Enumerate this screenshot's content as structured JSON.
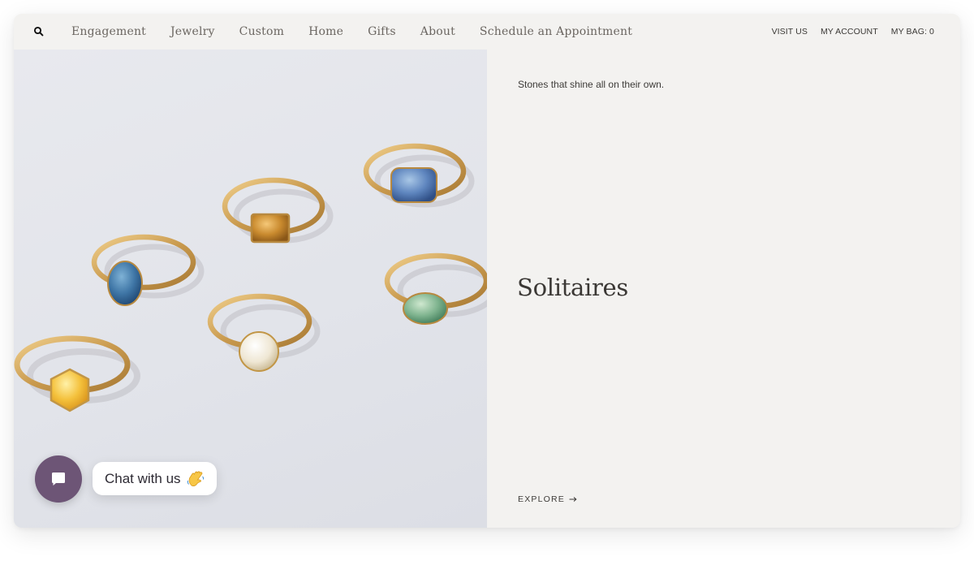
{
  "header": {
    "nav_links": [
      {
        "id": "engagement",
        "label": "Engagement"
      },
      {
        "id": "jewelry",
        "label": "Jewelry"
      },
      {
        "id": "custom",
        "label": "Custom"
      },
      {
        "id": "home",
        "label": "Home"
      },
      {
        "id": "gifts",
        "label": "Gifts"
      },
      {
        "id": "about",
        "label": "About"
      },
      {
        "id": "schedule",
        "label": "Schedule an Appointment"
      }
    ],
    "utility_links": [
      {
        "id": "visit-us",
        "label": "VISIT US"
      },
      {
        "id": "my-account",
        "label": "MY ACCOUNT"
      },
      {
        "id": "my-bag",
        "label": "MY BAG: 0"
      }
    ],
    "search_icon": "search-icon"
  },
  "hero": {
    "tagline": "Stones that shine all on their own.",
    "heading": "Solitaires",
    "explore_label": "EXPLORE",
    "explore_icon": "arrow-right-icon"
  },
  "chat": {
    "launcher_icon": "chat-bubble-icon",
    "label": "Chat with us",
    "emoji_icon": "waving-hand-icon"
  },
  "colors": {
    "page_bg": "#f3f2f0",
    "image_bg": "#e4e5eb",
    "chat_purple": "#6d5576",
    "text_dark": "#3b3835",
    "nav_text": "#6b6661"
  }
}
